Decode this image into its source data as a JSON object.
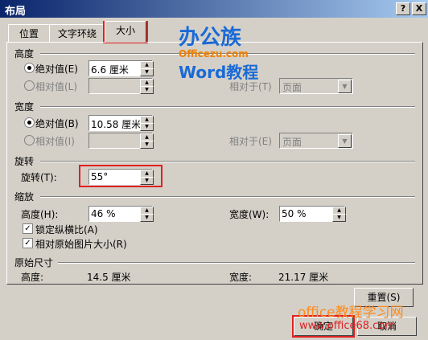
{
  "title": "布局",
  "title_buttons": [
    "?",
    "X"
  ],
  "tabs": [
    "位置",
    "文字环绕",
    "大小"
  ],
  "height": {
    "section": "高度",
    "absolute_label": "绝对值(E)",
    "absolute_value": "6.6 厘米",
    "relative_label": "相对值(L)",
    "relative_to_label": "相对于(T)",
    "relative_to_value": "页面"
  },
  "width": {
    "section": "宽度",
    "absolute_label": "绝对值(B)",
    "absolute_value": "10.58 厘米",
    "relative_label": "相对值(I)",
    "relative_to_label": "相对于(E)",
    "relative_to_value": "页面"
  },
  "rotation": {
    "section": "旋转",
    "label": "旋转(T):",
    "value": "55°"
  },
  "scale": {
    "section": "缩放",
    "height_label": "高度(H):",
    "height_value": "46 %",
    "width_label": "宽度(W):",
    "width_value": "50 %",
    "lock_aspect": "锁定纵横比(A)",
    "relative_original": "相对原始图片大小(R)"
  },
  "original": {
    "section": "原始尺寸",
    "height_label": "高度:",
    "height_value": "14.5 厘米",
    "width_label": "宽度:",
    "width_value": "21.17 厘米"
  },
  "buttons": {
    "reset": "重置(S)",
    "ok": "确定",
    "cancel": "取消"
  },
  "watermark": {
    "logo": "办公族",
    "site": "Officezu.com",
    "sub": "Word教程",
    "footer1": "office教程学习网",
    "footer2": "www.office68.com"
  },
  "colors": {
    "highlight": "#e02020",
    "title_bar": "#0a246a"
  }
}
